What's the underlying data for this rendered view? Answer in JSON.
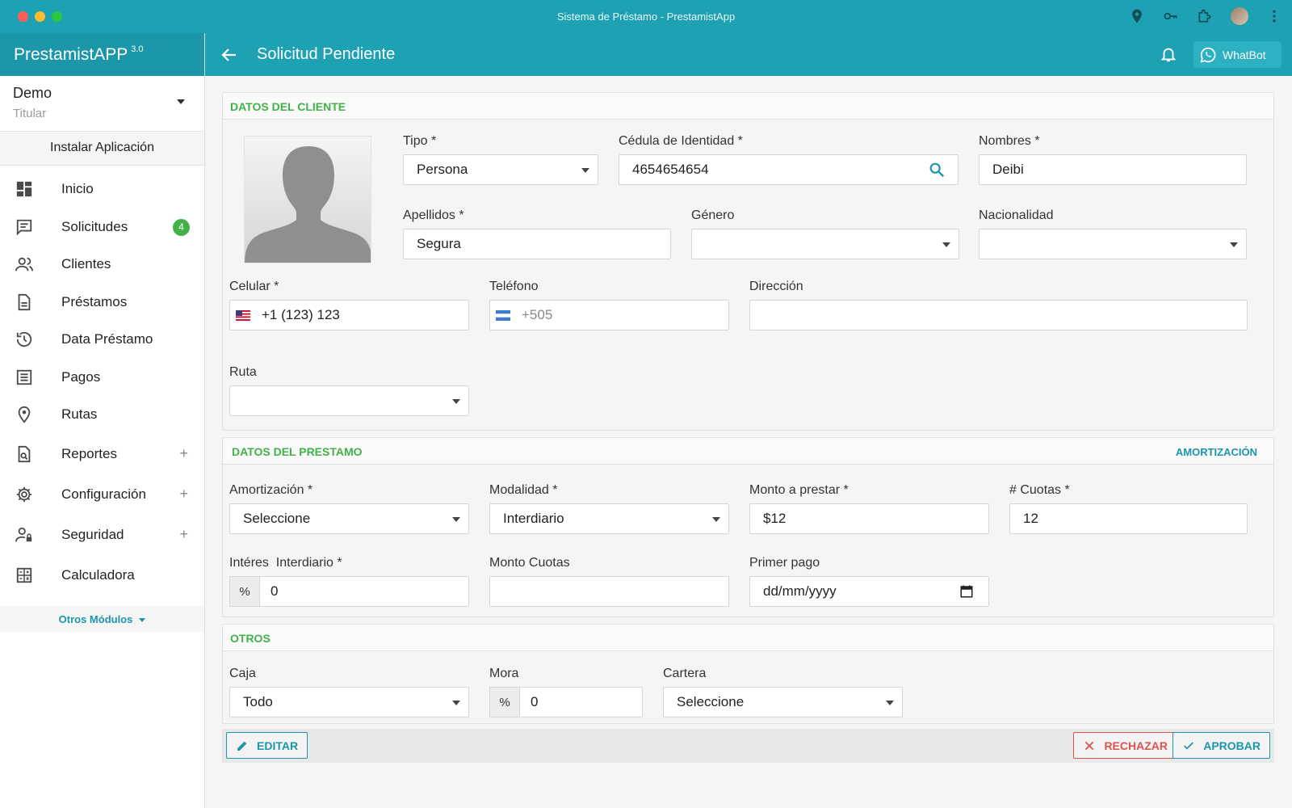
{
  "window": {
    "title": "Sistema de Préstamo - PrestamistApp"
  },
  "brand": {
    "name": "PrestamistAPP",
    "version": "3.0"
  },
  "user": {
    "name": "Demo",
    "role": "Titular"
  },
  "install_label": "Instalar Aplicación",
  "nav": {
    "items": [
      {
        "label": "Inicio",
        "icon": "dashboard-icon"
      },
      {
        "label": "Solicitudes",
        "icon": "chat-icon",
        "badge": "4"
      },
      {
        "label": "Clientes",
        "icon": "users-icon"
      },
      {
        "label": "Préstamos",
        "icon": "document-icon"
      },
      {
        "label": "Data Préstamo",
        "icon": "history-icon"
      },
      {
        "label": "Pagos",
        "icon": "list-icon"
      },
      {
        "label": "Rutas",
        "icon": "map-pin-icon"
      },
      {
        "label": "Reportes",
        "icon": "report-icon",
        "expand": "+"
      },
      {
        "label": "Configuración",
        "icon": "gear-icon",
        "expand": "+"
      },
      {
        "label": "Seguridad",
        "icon": "user-lock-icon",
        "expand": "+"
      },
      {
        "label": "Calculadora",
        "icon": "calculator-icon"
      }
    ],
    "otros_label": "Otros Módulos"
  },
  "header": {
    "title": "Solicitud Pendiente",
    "whatbot_label": "WhatBot"
  },
  "cliente": {
    "section_title": "DATOS DEL CLIENTE",
    "tipo": {
      "label": "Tipo *",
      "value": "Persona"
    },
    "cedula": {
      "label": "Cédula de Identidad *",
      "value": "4654654654"
    },
    "nombres": {
      "label": "Nombres *",
      "value": "Deibi"
    },
    "apellidos": {
      "label": "Apellidos *",
      "value": "Segura"
    },
    "genero": {
      "label": "Género",
      "value": ""
    },
    "nacionalidad": {
      "label": "Nacionalidad",
      "value": ""
    },
    "celular": {
      "label": "Celular *",
      "value": "+1 (123) 123"
    },
    "telefono": {
      "label": "Teléfono",
      "placeholder": "+505"
    },
    "direccion": {
      "label": "Dirección",
      "value": ""
    },
    "ruta": {
      "label": "Ruta",
      "value": ""
    }
  },
  "prestamo": {
    "section_title": "DATOS DEL PRESTAMO",
    "amortizacion_link": "AMORTIZACIÓN",
    "amortizacion": {
      "label": "Amortización *",
      "value": "Seleccione"
    },
    "modalidad": {
      "label": "Modalidad *",
      "value": "Interdiario"
    },
    "monto": {
      "label": "Monto a prestar *",
      "value": "$12"
    },
    "cuotas": {
      "label": "# Cuotas *",
      "value": "12"
    },
    "interes": {
      "label": "Intéres  Interdiario *",
      "addon": "%",
      "value": "0"
    },
    "monto_cuotas": {
      "label": "Monto Cuotas",
      "value": ""
    },
    "primer_pago": {
      "label": "Primer pago",
      "placeholder": "dd/mm/yyyy"
    }
  },
  "otros": {
    "section_title": "OTROS",
    "caja": {
      "label": "Caja",
      "value": "Todo"
    },
    "mora": {
      "label": "Mora",
      "addon": "%",
      "value": "0"
    },
    "cartera": {
      "label": "Cartera",
      "value": "Seleccione"
    }
  },
  "actions": {
    "editar": "EDITAR",
    "rechazar": "RECHAZAR",
    "aprobar": "APROBAR"
  },
  "colors": {
    "primary": "#1ea1b3",
    "brand_dark": "#1b97a9",
    "green": "#43b149",
    "danger": "#d9534f"
  }
}
